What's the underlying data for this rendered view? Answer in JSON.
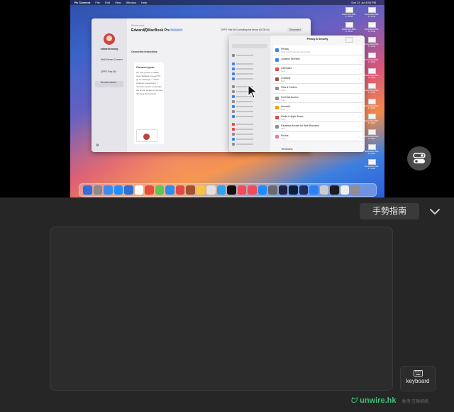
{
  "menubar": {
    "app": "Rx Connect",
    "items": [
      "File",
      "Edit",
      "View",
      "Window",
      "Help"
    ],
    "clock": "Sun 21 Jul 4:58 PM"
  },
  "window": {
    "device_label": "Device name",
    "device_name": "Edward的MacBook Pro",
    "badge": "Connected",
    "connected_text": "OPPO Find N5 Controlling this device (00:05:04)",
    "disconnect_label": "Disconnect",
    "user_name": "edwardcheung",
    "sidebar": [
      "Multi-Screen Connect",
      "OPPO Find N5",
      "Remote control"
    ],
    "instructions_title": "Connection instructions",
    "card_title": "Connect your",
    "card_text": "On your phone or tablet, open Settings on your PC, go to \"Settings\" > \"Other wireless connections\" > \"Control Center\" and swipe the Home screen to connect \"Remote PC Control\".",
    "session_label": "Current session"
  },
  "privacy": {
    "title": "Privacy & Security",
    "search_placeholder": "Search",
    "items": [
      {
        "label": "Privacy",
        "sub": "Control which apps can access data"
      },
      {
        "label": "Location Services",
        "sub": ""
      },
      {
        "label": "Calendars",
        "sub": "None"
      },
      {
        "label": "Contacts",
        "sub": "None"
      },
      {
        "label": "Files & Folders",
        "sub": "1 app"
      },
      {
        "label": "Full Disk Access",
        "sub": "1 app"
      },
      {
        "label": "HomeKit",
        "sub": "None"
      },
      {
        "label": "Media & Apple Music",
        "sub": "None"
      },
      {
        "label": "Passkeys Access for Web Browsers",
        "sub": "None"
      },
      {
        "label": "Photos",
        "sub": "1 app"
      }
    ],
    "footer": "Reminders"
  },
  "desktop_icons": [
    "Screenshot 2024-0...16.58",
    "Screenshot 2024-0...16.46",
    "Screenshot 2024-0...16.44",
    "Screenshot 2024-0...16.40",
    "Screenshot 2024-0...16.36",
    "Screenshot 2024-0...16.33",
    "Screenshot 2024-0...16.31",
    "Screenshot 2024-0...16.28",
    "Screenshot 2024-0...16.25",
    "Screenshot 2024-0...16.22",
    "Screenshot 2024-0...16.18",
    "Screenshot 2024-0...16.12",
    "Screenshot 2024-0...16.05",
    "Screenshot 2024-0...15.58"
  ],
  "dock_colors": [
    "#2f6fd6",
    "#8a8a8a",
    "#3b8cf0",
    "#1e90ff",
    "#2e6fd0",
    "#ffffff",
    "#e94c3a",
    "#5fc452",
    "#2d8cf0",
    "#e34848",
    "#a0522d",
    "#f5c542",
    "#e0e0e0",
    "#30a0f0",
    "#111111",
    "#f24a5c",
    "#f24a5c",
    "#1a8cff",
    "#6a6a6a",
    "#222244",
    "#0b1f3b",
    "#1d2e5f",
    "#2d7ff9",
    "#cccccc",
    "#1c1c1c",
    "#eeeeee",
    "#8e8e93"
  ],
  "controls": {
    "gesture_label": "手勢指南",
    "keyboard_label": "keyboard",
    "watermark": "unwire.hk",
    "watermark_sub": "香港 互聯網絡"
  },
  "colors": {
    "accent_green": "#3cc07a",
    "control_bg": "#262626",
    "pad_bg": "#2c2c2c"
  }
}
